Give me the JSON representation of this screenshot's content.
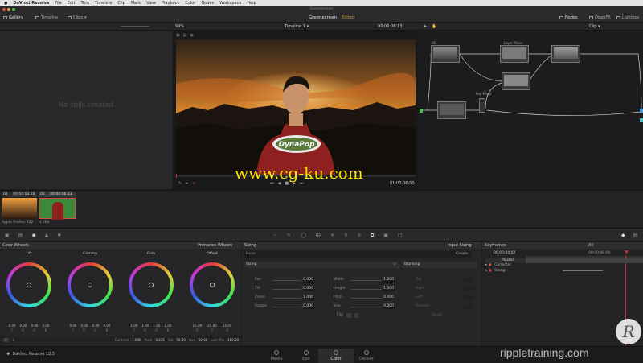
{
  "menubar": {
    "app_name": "DaVinci Resolve",
    "items": [
      "File",
      "Edit",
      "Trim",
      "Timeline",
      "Clip",
      "Mark",
      "View",
      "Playback",
      "Color",
      "Nodes",
      "Workspace",
      "Help"
    ]
  },
  "window": {
    "title": "Greenscreen"
  },
  "topbar": {
    "gallery_label": "Gallery",
    "timeline_label": "Timeline",
    "clips_label": "Clips",
    "project_name": "Greenscreen",
    "project_status": "Edited",
    "nodes_label": "Nodes",
    "openfx_label": "OpenFX",
    "lightbox_label": "Lightbox"
  },
  "viewer": {
    "zoom": "99%",
    "timeline_name": "Timeline 1",
    "timecode": "00:00:06:13",
    "overlay_timecode": "01:00:06:00",
    "tshirt_text": "DynaPop"
  },
  "node_editor": {
    "mode_label": "Clip",
    "nodes": [
      {
        "id": "01",
        "label": ""
      },
      {
        "id": "02",
        "label": "Layer Mixer"
      },
      {
        "id": "03",
        "label": ""
      },
      {
        "id": "04",
        "label": "Key Mixer"
      },
      {
        "id": "05",
        "label": ""
      }
    ]
  },
  "gallery": {
    "empty_message": "No stills created"
  },
  "clips": [
    {
      "index": "01",
      "timecode": "00:04:03:28",
      "name": "Apple ProRes 422"
    },
    {
      "index": "02",
      "timecode": "00:00:06:13",
      "name": "H.264"
    }
  ],
  "color_wheels": {
    "title": "Color Wheels",
    "mode": "Primaries Wheels",
    "wheels": [
      {
        "name": "Lift",
        "values": [
          "0.00",
          "0.00",
          "0.00",
          "0.00"
        ],
        "channels": [
          "Y",
          "R",
          "G",
          "B"
        ]
      },
      {
        "name": "Gamma",
        "values": [
          "0.00",
          "0.00",
          "0.00",
          "0.00"
        ],
        "channels": [
          "Y",
          "R",
          "G",
          "B"
        ]
      },
      {
        "name": "Gain",
        "values": [
          "1.00",
          "1.00",
          "1.00",
          "1.00"
        ],
        "channels": [
          "Y",
          "R",
          "G",
          "B"
        ]
      },
      {
        "name": "Offset",
        "values": [
          "25.00",
          "25.00",
          "25.00"
        ],
        "channels": [
          "R",
          "G",
          "B"
        ]
      }
    ],
    "footer": {
      "contrast_label": "Contrast",
      "contrast": "1.000",
      "pivot_label": "Pivot",
      "pivot": "0.435",
      "sat_label": "Sat",
      "sat": "50.00",
      "hue_label": "Hue",
      "hue": "50.00",
      "lummix_label": "Lum Mix",
      "lummix": "100.00"
    }
  },
  "sizing": {
    "title": "Sizing",
    "mode": "Input Sizing",
    "preset_label": "None",
    "create_label": "Create",
    "section_label": "Sizing",
    "blanking_label": "Blanking",
    "rows_left": [
      {
        "label": "Pan",
        "value": "0.000"
      },
      {
        "label": "Tilt",
        "value": "0.000"
      },
      {
        "label": "Zoom",
        "value": "1.000"
      },
      {
        "label": "Rotate",
        "value": "0.000"
      }
    ],
    "rows_right": [
      {
        "label": "Width",
        "value": "1.000"
      },
      {
        "label": "Height",
        "value": "1.000"
      },
      {
        "label": "Pitch",
        "value": "0.000"
      },
      {
        "label": "Yaw",
        "value": "0.000"
      }
    ],
    "flip_label": "Flip",
    "blanking_rows": [
      "Top",
      "Right",
      "Left",
      "Bottom"
    ],
    "blanking_reset": "Reset"
  },
  "keyframes": {
    "title": "Keyframes",
    "filter": "All",
    "timecode": "00:00:04:02",
    "end_timecode": "00:00:06:00",
    "tracks": [
      "Master",
      "Corrector",
      "Sizing"
    ]
  },
  "bottombar": {
    "brand": "DaVinci Resolve 12.5",
    "pages": [
      "Media",
      "Edit",
      "Color",
      "Deliver"
    ],
    "active_page": "Color"
  },
  "watermarks": {
    "center": "www.cg-ku.com",
    "corner": "rippletraining.com"
  }
}
